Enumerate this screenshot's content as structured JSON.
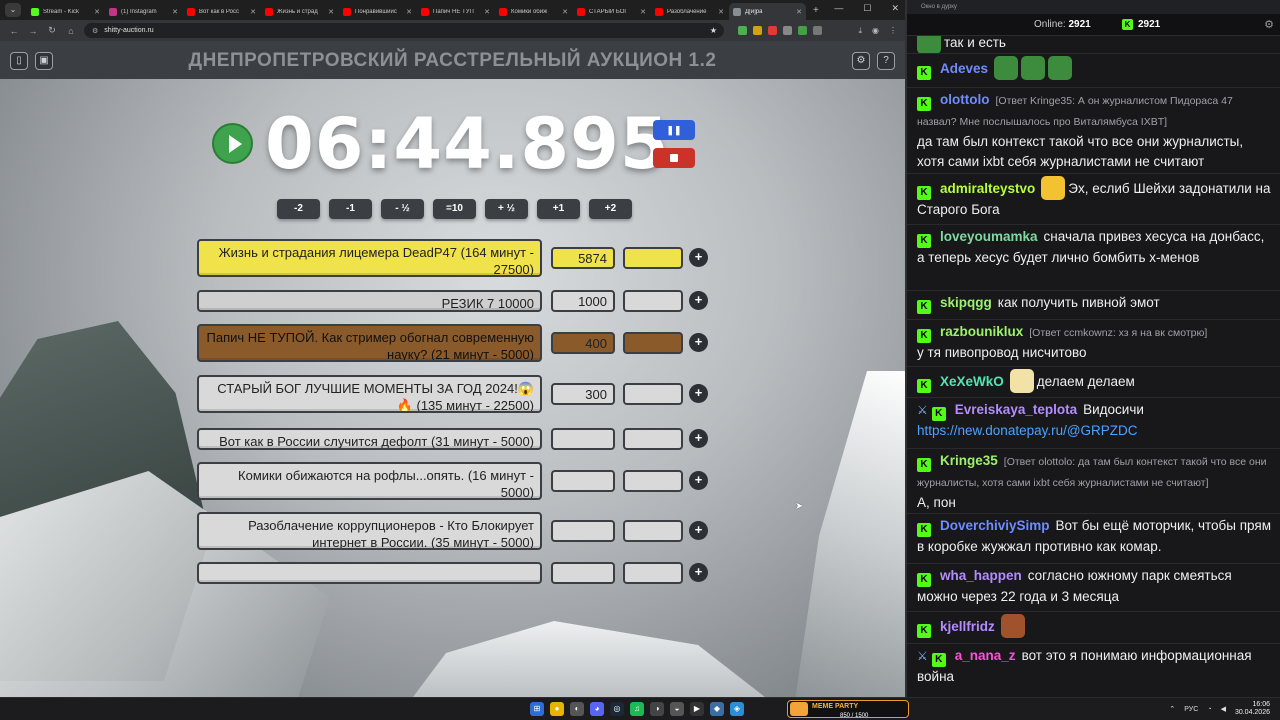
{
  "browser": {
    "tabs": [
      {
        "title": "Stream - Kick",
        "color": "#53fc18"
      },
      {
        "title": "(1) Instagram",
        "color": "#c13584"
      },
      {
        "title": "Вот как в Росс",
        "color": "#ff0000"
      },
      {
        "title": "Жизнь и страд",
        "color": "#ff0000"
      },
      {
        "title": "Понравившийс",
        "color": "#ff0000"
      },
      {
        "title": "Папич НЕ ТУП",
        "color": "#ff0000"
      },
      {
        "title": "Комики обиж",
        "color": "#ff0000"
      },
      {
        "title": "СТАРЫЙ БОГ",
        "color": "#ff0000"
      },
      {
        "title": "Разоблачение",
        "color": "#ff0000"
      },
      {
        "title": "Д[и]ра",
        "color": "#8a8f94"
      }
    ],
    "new_tab": "+",
    "url": "shitty-auction.ru",
    "nav": {
      "back": "←",
      "forward": "→",
      "reload": "↻",
      "home": "⌂"
    },
    "window_controls": {
      "minimize": "—",
      "maximize": "☐",
      "close": "✕"
    }
  },
  "page": {
    "title": "ДНЕПРОПЕТРОВСКИЙ РАССТРЕЛЬНЫЙ АУКЦИОН 1.2",
    "timer": "06:44.895",
    "pause_label": "❚❚",
    "time_buttons": [
      "-2",
      "-1",
      "- ½",
      "=10",
      "+ ½",
      "+1",
      "+2"
    ],
    "lots": [
      {
        "name": "Жизнь и страдания лицемера DeadP47 (164 минут - 27500)",
        "amount": "5874",
        "color": "#f0e24a",
        "add_color": "#f0e24a"
      },
      {
        "name": "РЕЗИК 7 10000",
        "amount": "1000",
        "color": "#cfcfcf",
        "add_color": "#d9d9d9"
      },
      {
        "name": "Папич НЕ ТУПОЙ. Как стример обогнал современную науку? (21 минут - 5000)",
        "amount": "400",
        "color": "#8b5a2b",
        "add_color": "#8b5a2b"
      },
      {
        "name": "СТАРЫЙ БОГ ЛУЧШИЕ МОМЕНТЫ ЗА ГОД 2024!😱 🔥 (135 минут - 22500)",
        "amount": "300",
        "color": "#d9d9d9",
        "add_color": "#d9d9d9"
      },
      {
        "name": "Вот как в России случится дефолт (31 минут - 5000)",
        "amount": "",
        "color": "#d9d9d9",
        "add_color": "#d9d9d9"
      },
      {
        "name": "Комики обижаются на рофлы...опять. (16 минут - 5000)",
        "amount": "",
        "color": "#d9d9d9",
        "add_color": "#d9d9d9"
      },
      {
        "name": "Разоблачение коррупционеров - Кто Блокирует интернет в России. (35 минут - 5000)",
        "amount": "",
        "color": "#d9d9d9",
        "add_color": "#d9d9d9"
      },
      {
        "name": "",
        "amount": "",
        "color": "#d9d9d9",
        "add_color": "#d9d9d9"
      }
    ],
    "plus": "+"
  },
  "chat": {
    "window_title": "Окно в дурку",
    "online_label": "Online:",
    "online_count": "2921",
    "kick_count": "2921",
    "messages": [
      {
        "user": "",
        "text": "так и есть",
        "reply": ""
      },
      {
        "user": "Adeves",
        "user_color": "#6f8cff",
        "text": "",
        "reply": ""
      },
      {
        "user": "olottolo",
        "user_color": "#6f8cff",
        "reply": "[Ответ Kringe35: А он журналистом Пидораса 47 назвал? Мне послышалось про Виталямбуса IXBT]",
        "text": "да там был контекст такой что все они журналисты, хотя сами ixbt себя журналистами не считают"
      },
      {
        "user": "admiralteystvo",
        "user_color": "#b6ff3b",
        "text": "Эх, еслиб Шейхи задонатили на Старого Бога",
        "reply": ""
      },
      {
        "user": "loveyoumamka",
        "user_color": "#7fd9a0",
        "text": "сначала привез хесуса на донбасс, а теперь хесус будет лично бомбить х-менов",
        "reply": ""
      },
      {
        "user": "skipqgg",
        "user_color": "#9cf36b",
        "text": "как получить пивной эмот",
        "reply": ""
      },
      {
        "user": "razbouniklux",
        "user_color": "#9cf36b",
        "reply": "[Ответ ccmkownz: хз я на вк смотрю]",
        "text": "у тя пивопровод нисчитово"
      },
      {
        "user": "XeXeWkO",
        "user_color": "#50e6b0",
        "text": "делаем делаем",
        "reply": ""
      },
      {
        "user": "Evreiskaya_teplota",
        "user_color": "#b48cff",
        "text": "Видосичи",
        "reply": "",
        "link": "https://new.donatepay.ru/@GRPZDC"
      },
      {
        "user": "Kringe35",
        "user_color": "#9cf36b",
        "reply": "[Ответ olottolo: да там был контекст такой что все они журналисты, хотя сами ixbt себя журналистами не считают]",
        "text": "А, пон"
      },
      {
        "user": "DoverchiviySimp",
        "user_color": "#6f8cff",
        "text": "Вот бы ещё моторчик, чтобы прям в коробке жужжал противно как комар.",
        "reply": ""
      },
      {
        "user": "wha_happen",
        "user_color": "#b48cff",
        "text": "согласно южному парк смеяться можно через 22 года и 3 месяца",
        "reply": ""
      },
      {
        "user": "kjellfridz",
        "user_color": "#b48cff",
        "text": "",
        "reply": ""
      },
      {
        "user": "a_nana_z",
        "user_color": "#ff4fd8",
        "text": "вот это я понимаю информационная война",
        "reply": ""
      }
    ]
  },
  "taskbar": {
    "meme_title": "MEME PARTY",
    "meme_value": "850 / 1500",
    "lang": "РУС",
    "time": "16:06",
    "date": "30.04.2026"
  }
}
